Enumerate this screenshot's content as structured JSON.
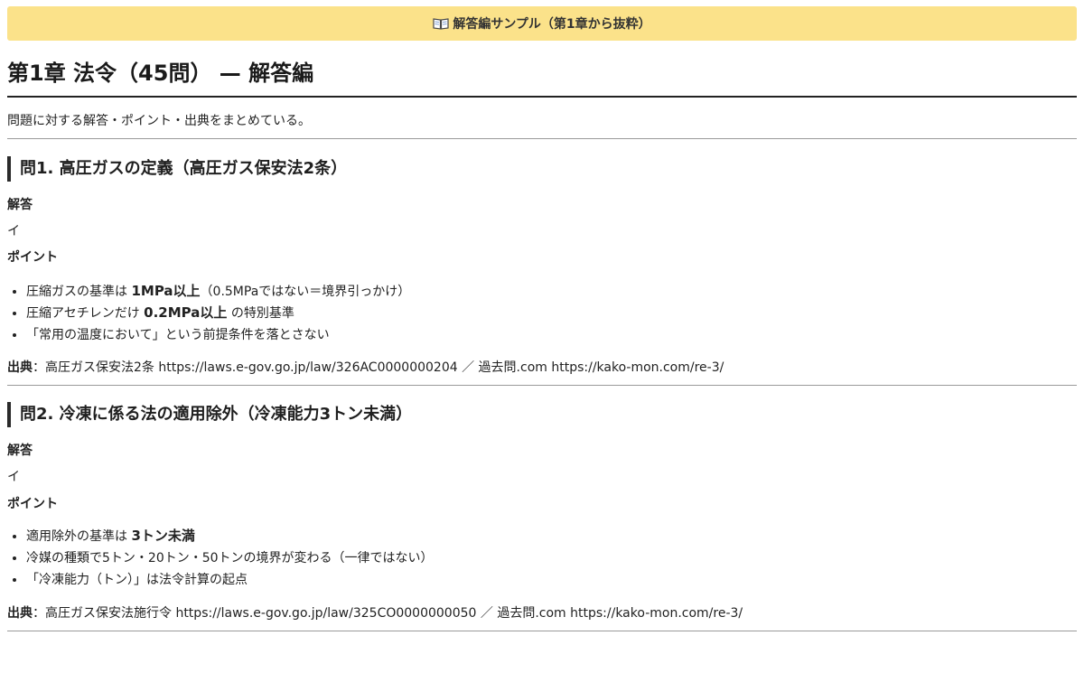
{
  "banner": {
    "icon": "open-book-icon",
    "text": "解答編サンプル（第1章から抜粋）",
    "color": "#fbe28a"
  },
  "page": {
    "title": "第1章 法令（45問） — 解答編",
    "intro": "問題に対する解答・ポイント・出典をまとめている。"
  },
  "questions": [
    {
      "heading": "問1. 高圧ガスの定義（高圧ガス保安法2条）",
      "answer_label": "解答",
      "answer": "イ",
      "points_label": "ポイント",
      "points": [
        {
          "pre": "圧縮ガスの基準は ",
          "strong": "1MPa以上",
          "post": "（0.5MPaではない＝境界引っかけ）"
        },
        {
          "pre": "圧縮アセチレンだけ ",
          "strong": "0.2MPa以上",
          "post": " の特別基準"
        },
        {
          "pre": "「常用の温度において」という前提条件を落とさない",
          "strong": "",
          "post": ""
        }
      ],
      "source_label": "出典",
      "source_text": "：高圧ガス保安法2条 https://laws.e-gov.go.jp/law/326AC0000000204 ／ 過去問.com https://kako-mon.com/re-3/"
    },
    {
      "heading": "問2. 冷凍に係る法の適用除外（冷凍能力3トン未満）",
      "answer_label": "解答",
      "answer": "イ",
      "points_label": "ポイント",
      "points": [
        {
          "pre": "適用除外の基準は ",
          "strong": "3トン未満",
          "post": ""
        },
        {
          "pre": "冷媒の種類で5トン・20トン・50トンの境界が変わる（一律ではない）",
          "strong": "",
          "post": ""
        },
        {
          "pre": "「冷凍能力（トン）」は法令計算の起点",
          "strong": "",
          "post": ""
        }
      ],
      "source_label": "出典",
      "source_text": "：高圧ガス保安法施行令 https://laws.e-gov.go.jp/law/325CO0000000050 ／ 過去問.com https://kako-mon.com/re-3/"
    }
  ]
}
